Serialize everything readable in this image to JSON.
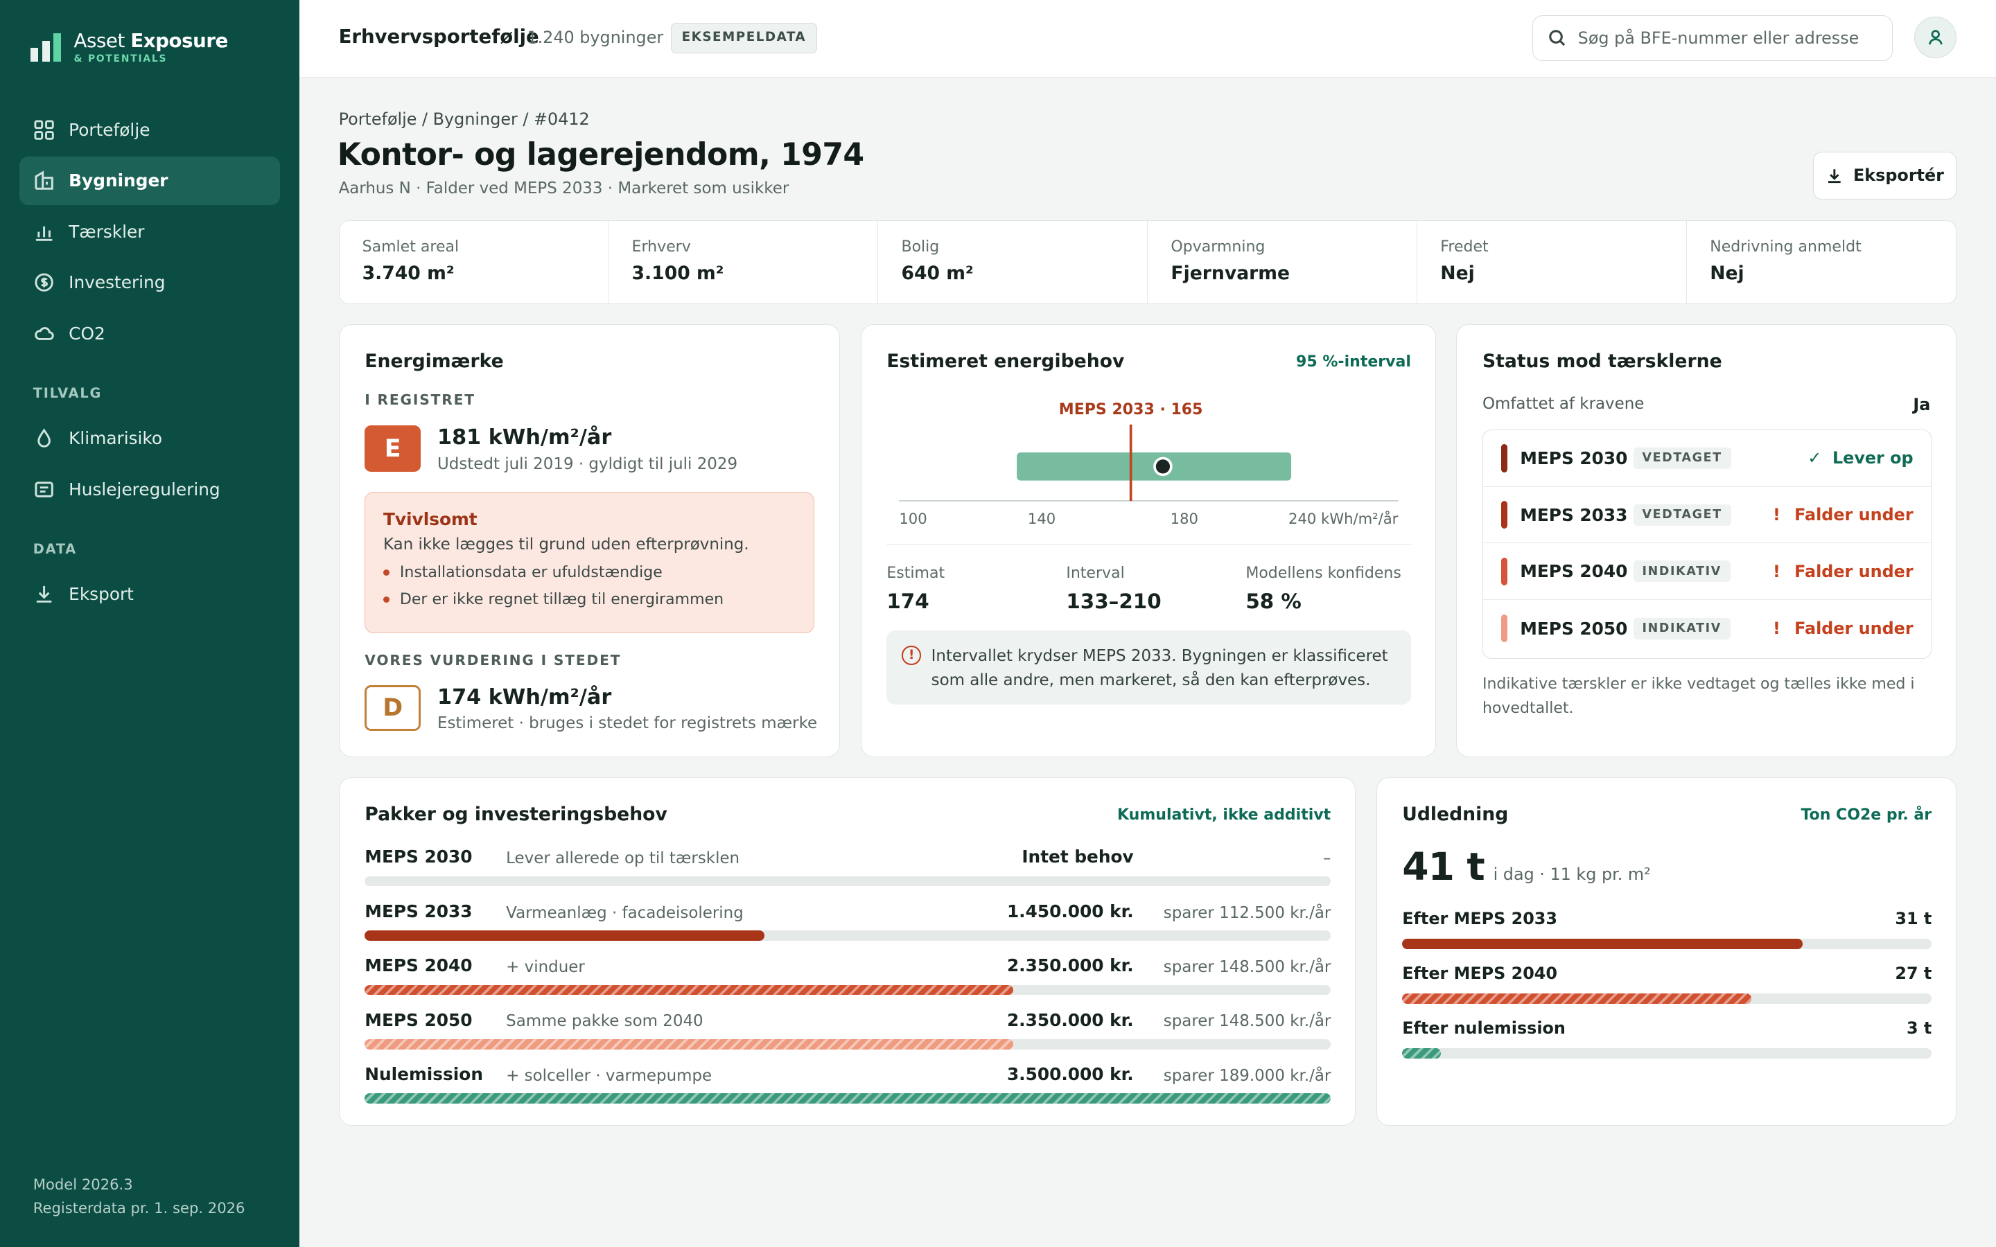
{
  "app": {
    "name_light": "Asset ",
    "name_bold": "Exposure",
    "sub": "& POTENTIALS"
  },
  "nav": {
    "items": [
      {
        "label": "Portefølje",
        "icon": "grid-icon"
      },
      {
        "label": "Bygninger",
        "icon": "building-icon",
        "active": true
      },
      {
        "label": "Tærskler",
        "icon": "bar-chart-icon"
      },
      {
        "label": "Investering",
        "icon": "coin-icon"
      },
      {
        "label": "CO2",
        "icon": "cloud-icon"
      }
    ],
    "section_options": "TILVALG",
    "options": [
      {
        "label": "Klimarisiko",
        "icon": "drop-icon"
      },
      {
        "label": "Huslejeregulering",
        "icon": "document-icon"
      }
    ],
    "section_data": "DATA",
    "data_items": [
      {
        "label": "Eksport",
        "icon": "download-icon"
      }
    ],
    "footer_model": "Model 2026.3",
    "footer_data": "Registerdata pr. 1. sep. 2026"
  },
  "topbar": {
    "title": "Erhvervsportefølje",
    "count": "1.240 bygninger",
    "badge": "EKSEMPELDATA",
    "search_placeholder": "Søg på BFE-nummer eller adresse"
  },
  "page": {
    "breadcrumb": "Portefølje / Bygninger / #0412",
    "title": "Kontor- og lagerejendom, 1974",
    "subtitle": "Aarhus N · Falder ved MEPS 2033 · Markeret som usikker",
    "export_label": "Eksportér"
  },
  "facts": [
    {
      "label": "Samlet areal",
      "value": "3.740 m²"
    },
    {
      "label": "Erhverv",
      "value": "3.100 m²"
    },
    {
      "label": "Bolig",
      "value": "640 m²"
    },
    {
      "label": "Opvarmning",
      "value": "Fjernvarme"
    },
    {
      "label": "Fredet",
      "value": "Nej"
    },
    {
      "label": "Nedrivning anmeldt",
      "value": "Nej"
    }
  ],
  "energy_label": {
    "title": "Energimærke",
    "registered_heading": "I REGISTRET",
    "registered_grade": "E",
    "registered_value": "181 kWh/m²/år",
    "registered_sub": "Udstedt juli 2019 · gyldigt til juli 2029",
    "warning_title": "Tvivlsomt",
    "warning_text": "Kan ikke lægges til grund uden efterprøvning.",
    "warning_items": [
      "Installationsdata er ufuldstændige",
      "Der er ikke regnet tillæg til energirammen"
    ],
    "assessment_heading": "VORES VURDERING I STEDET",
    "assessment_grade": "D",
    "assessment_value": "174 kWh/m²/år",
    "assessment_sub": "Estimeret · bruges i stedet for registrets mærke"
  },
  "estimate": {
    "title": "Estimeret energibehov",
    "interval_link": "95 %-interval",
    "marker_label": "MEPS 2033 · 165",
    "stats": [
      {
        "label": "Estimat",
        "value": "174"
      },
      {
        "label": "Interval",
        "value": "133–210"
      },
      {
        "label": "Modellens konfidens",
        "value": "58 %"
      }
    ],
    "info": "Intervallet krydser MEPS 2033. Bygningen er klassificeret som alle andre, men markeret, så den kan efterprøves."
  },
  "chart_data": {
    "type": "interval",
    "x_ticks": [
      "100",
      "140",
      "180",
      "240 kWh/m²/år"
    ],
    "xlim": [
      100,
      240
    ],
    "estimate": 174,
    "interval": [
      133,
      210
    ],
    "threshold": {
      "label": "MEPS 2033 · 165",
      "value": 165
    },
    "colors": {
      "interval": "#78bca0",
      "threshold": "#c0451f",
      "estimate": "#1b2623"
    }
  },
  "thresholds": {
    "title": "Status mod tærsklerne",
    "covered_label": "Omfattet af kravene",
    "covered_value": "Ja",
    "rows": [
      {
        "name": "MEPS 2030",
        "tag": "VEDTAGET",
        "status": "Lever op",
        "ok": true,
        "color": "#8c2a16"
      },
      {
        "name": "MEPS 2033",
        "tag": "VEDTAGET",
        "status": "Falder under",
        "ok": false,
        "color": "#a83518"
      },
      {
        "name": "MEPS 2040",
        "tag": "INDIKATIV",
        "status": "Falder under",
        "ok": false,
        "color": "#d4553a"
      },
      {
        "name": "MEPS 2050",
        "tag": "INDIKATIV",
        "status": "Falder under",
        "ok": false,
        "color": "#ef9b85"
      }
    ],
    "note": "Indikative tærskler er ikke vedtaget og tælles ikke med i hovedtallet."
  },
  "packages": {
    "title": "Pakker og investeringsbehov",
    "link": "Kumulativt, ikke additivt",
    "rows": [
      {
        "name": "MEPS 2030",
        "desc": "Lever allerede op til tærsklen",
        "cost": "Intet behov",
        "saving": "–",
        "fraction": 0,
        "color": "#a83518",
        "pattern": "solid"
      },
      {
        "name": "MEPS 2033",
        "desc": "Varmeanlæg · facadeisolering",
        "cost": "1.450.000 kr.",
        "saving": "sparer 112.500 kr./år",
        "fraction": 0.414,
        "color": "#a83518",
        "pattern": "solid"
      },
      {
        "name": "MEPS 2040",
        "desc": "+ vinduer",
        "cost": "2.350.000 kr.",
        "saving": "sparer 148.500 kr./år",
        "fraction": 0.671,
        "color": "#d0502f",
        "pattern": "striped"
      },
      {
        "name": "MEPS 2050",
        "desc": "Samme pakke som 2040",
        "cost": "2.350.000 kr.",
        "saving": "sparer 148.500 kr./år",
        "fraction": 0.671,
        "color": "#ef9b7f",
        "pattern": "striped"
      },
      {
        "name": "Nulemission",
        "desc": "+ solceller · varmepumpe",
        "cost": "3.500.000 kr.",
        "saving": "sparer 189.000 kr./år",
        "fraction": 1,
        "color": "#3b9a7c",
        "pattern": "striped"
      }
    ]
  },
  "emissions": {
    "title": "Udledning",
    "unit_link": "Ton CO2e pr. år",
    "big_value": "41 t",
    "big_sub": "i dag · 11 kg pr. m²",
    "rows": [
      {
        "label": "Efter MEPS 2033",
        "value": "31 t",
        "fraction": 0.756,
        "color": "#a83518",
        "pattern": "solid"
      },
      {
        "label": "Efter MEPS 2040",
        "value": "27 t",
        "fraction": 0.659,
        "color": "#d0502f",
        "pattern": "striped"
      },
      {
        "label": "Efter nulemission",
        "value": "3 t",
        "fraction": 0.073,
        "color": "#3b9a7c",
        "pattern": "striped"
      }
    ]
  }
}
